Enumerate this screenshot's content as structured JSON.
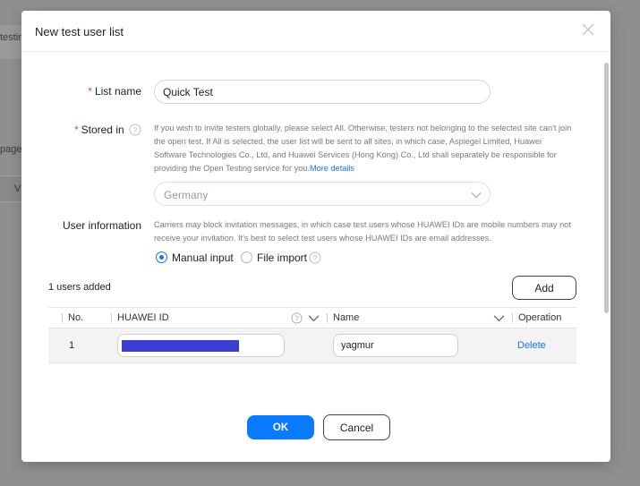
{
  "background": {
    "fragment_1": "testin",
    "fragment_2": "page.",
    "fragment_3": "V"
  },
  "modal": {
    "title": "New test user list",
    "close_icon": "close-icon"
  },
  "form": {
    "list_name": {
      "required_mark": "*",
      "label": "List name",
      "value": "Quick Test"
    },
    "stored_in": {
      "required_mark": "*",
      "label": "Stored in",
      "hint": "If you wish to invite testers globally, please select All. Otherwise, testers not belonging to the selected site can't join the open test. If All is selected, the user list will be sent to all sites, in which case, Aspiegel Limited, Huawei Software Technologies Co., Ltd, and Huawei Services (Hong Kong) Co., Ltd shall separately be responsible for providing the Open Testing service for you.",
      "link_text": "More details",
      "selected": "Germany"
    },
    "user_information": {
      "label": "User information",
      "hint": "Carriers may block invitation messages, in which case test users whose HUAWEI IDs are mobile numbers may not receive your invitation. It's best to select test users whose HUAWEI IDs are email addresses.",
      "options": [
        {
          "label": "Manual input",
          "checked": true
        },
        {
          "label": "File import",
          "checked": false
        }
      ]
    }
  },
  "users": {
    "count_text": "1 users added",
    "add_label": "Add",
    "columns": {
      "no": "No.",
      "huawei_id": "HUAWEI ID",
      "name": "Name",
      "operation": "Operation"
    },
    "rows": [
      {
        "no": "1",
        "huawei_id": "",
        "name": "yagmur",
        "action": "Delete"
      }
    ]
  },
  "footer": {
    "ok_label": "OK",
    "cancel_label": "Cancel"
  },
  "colors": {
    "primary": "#0a7aff",
    "link": "#1a73e8",
    "required": "#e84040",
    "redaction": "#3a3fcf"
  }
}
